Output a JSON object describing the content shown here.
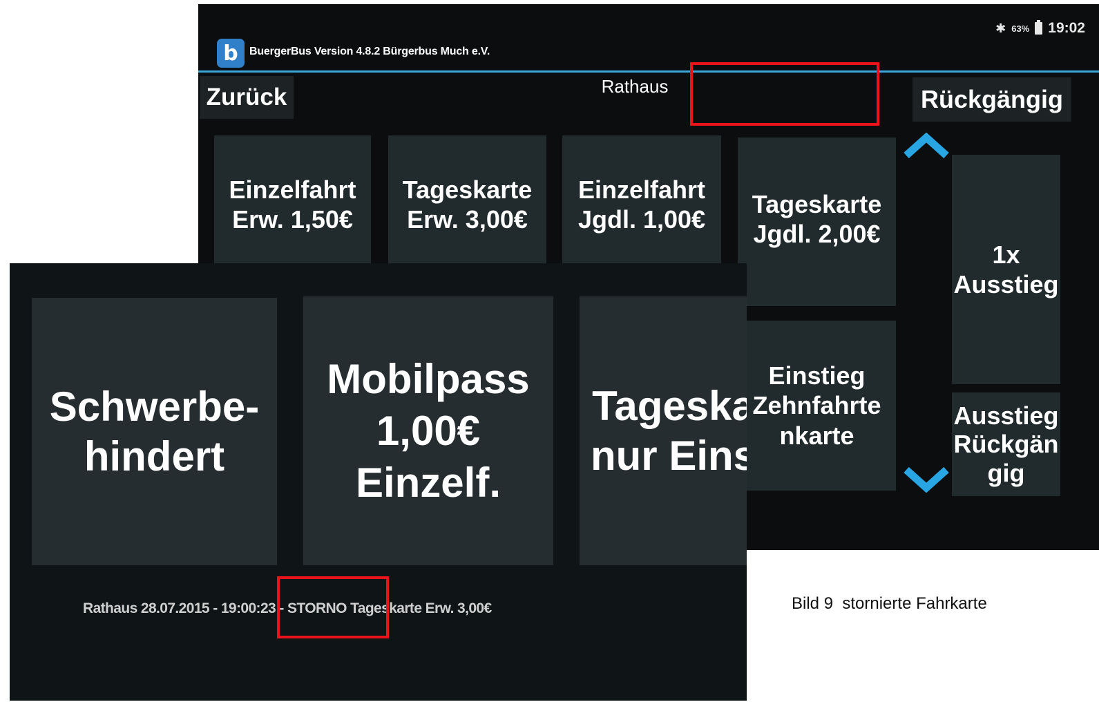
{
  "status_bar": {
    "bluetooth_icon": "bluetooth-icon",
    "battery_percent": "63%",
    "battery_icon": "battery-icon",
    "time": "19:02"
  },
  "app": {
    "logo_icon": "buergerbus-logo",
    "logo_glyph": "b",
    "title": "BuergerBus Version 4.8.2 Bürgerbus Much e.V.",
    "accent_color": "#3aa7de"
  },
  "toolbar": {
    "back_label": "Zurück",
    "stop_name": "Rathaus",
    "undo_label": "Rückgängig"
  },
  "tickets_back": [
    "Einzelfahrt\nErw. 1,50€",
    "Tageskarte\nErw. 3,00€",
    "Einzelfahrt\nJgdl. 1,00€",
    "Tageskarte\nJgdl. 2,00€",
    "Einstieg\nZehnfahrte\nnkarte"
  ],
  "side_buttons": {
    "exit_once": "1x\nAusstieg",
    "exit_undo": "Ausstieg\nRückgän\ngig",
    "scroll_up_icon": "chevron-up-icon",
    "scroll_down_icon": "chevron-down-icon"
  },
  "tickets_front": [
    "Schwerbe-\nhindert",
    "Mobilpass\n1,00€\nEinzelf.",
    "Tageska\nnur Eins"
  ],
  "log": {
    "entry": "Rathaus 28.07.2015 - 19:00:23 - STORNO Tageskarte Erw. 3,00€"
  },
  "caption": "Bild 9  stornierte Fahrkarte",
  "highlight_color": "#e8141a"
}
